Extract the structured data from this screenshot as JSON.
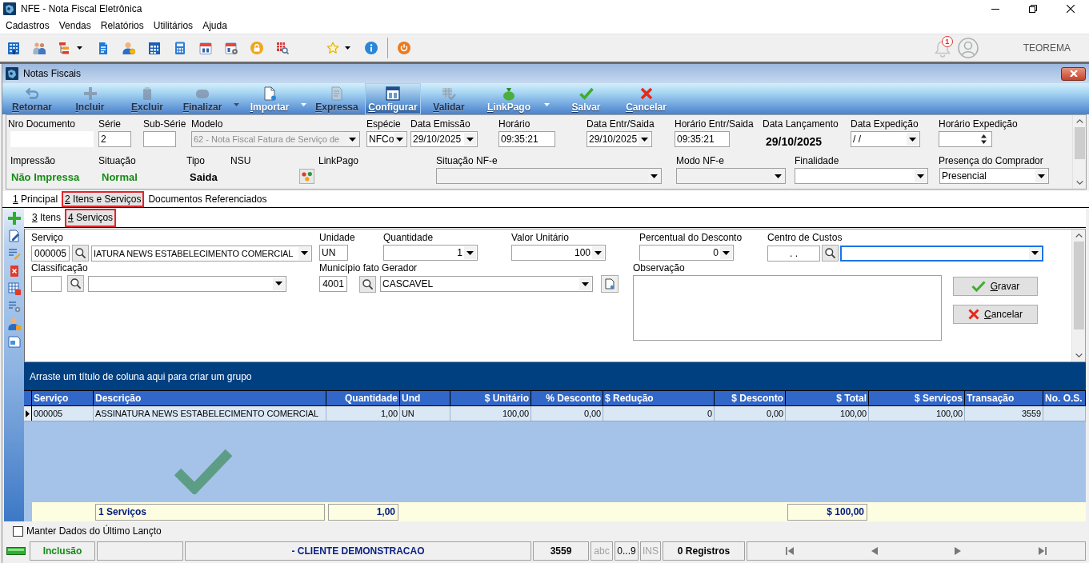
{
  "window": {
    "title": "NFE - Nota Fiscal Eletrônica"
  },
  "menu": [
    "Cadastros",
    "Vendas",
    "Relatórios",
    "Utilitários",
    "Ajuda"
  ],
  "toolbar": {
    "notification_count": "1",
    "user_name": "TEOREMA"
  },
  "child_window": {
    "title": "Notas Fiscais"
  },
  "ribbon": [
    {
      "label": "Retornar",
      "disabled": true,
      "dropdown": false,
      "hovered": false
    },
    {
      "label": "Incluir",
      "disabled": true,
      "dropdown": false,
      "hovered": false
    },
    {
      "label": "Excluir",
      "disabled": true,
      "dropdown": false,
      "hovered": false
    },
    {
      "label": "Finalizar",
      "disabled": true,
      "dropdown": true,
      "hovered": false
    },
    {
      "label": "Importar",
      "disabled": false,
      "dropdown": true,
      "hovered": false
    },
    {
      "label": "Expressa",
      "disabled": true,
      "dropdown": false,
      "hovered": false
    },
    {
      "label": "Configurar",
      "disabled": false,
      "dropdown": false,
      "hovered": true
    },
    {
      "label": "Validar",
      "disabled": true,
      "dropdown": false,
      "hovered": false
    },
    {
      "label": "LinkPago",
      "disabled": false,
      "dropdown": true,
      "hovered": false
    },
    {
      "label": "Salvar",
      "disabled": false,
      "dropdown": false,
      "hovered": false
    },
    {
      "label": "Cancelar",
      "disabled": false,
      "dropdown": false,
      "hovered": false
    }
  ],
  "header": {
    "row_1": [
      {
        "label": "Nro Documento",
        "kind": "plain",
        "disabled": false
      },
      {
        "label": "Série",
        "kind": "input",
        "value": "2",
        "disabled": false
      },
      {
        "label": "Sub-Série",
        "kind": "input",
        "disabled": false
      },
      {
        "label": "Modelo",
        "kind": "dropdown",
        "value": "62 - Nota Fiscal Fatura de Serviço de",
        "disabled": true
      },
      {
        "label": "Espécie",
        "kind": "dropdown",
        "value": "NFCo",
        "disabled": false
      },
      {
        "label": "Data Emissão",
        "kind": "dropdown",
        "value": "29/10/2025",
        "disabled": false
      },
      {
        "label": "Horário",
        "kind": "input",
        "value": "09:35:21",
        "disabled": false
      },
      {
        "label": "Data Entr/Saida",
        "kind": "dropdown",
        "value": "29/10/2025",
        "disabled": false
      },
      {
        "label": "Horário Entr/Saida",
        "kind": "input",
        "value": "09:35:21",
        "disabled": false
      },
      {
        "label": "Data Lançamento",
        "kind": "text",
        "value": "29/10/2025",
        "disabled": false
      },
      {
        "label": "Data Expedição",
        "kind": "dropdown",
        "value": "/ /",
        "disabled": false
      },
      {
        "label": "Horário Expedição",
        "kind": "spin",
        "disabled": false
      }
    ],
    "row_2": [
      {
        "label": "Impressão",
        "kind": "status",
        "value": "Não Impressa",
        "color": "#168a16",
        "disabled": false
      },
      {
        "label": "Situação",
        "kind": "status",
        "value": "Normal",
        "color": "#168a16",
        "disabled": false
      },
      {
        "label": "Tipo",
        "kind": "status",
        "value": "Saida",
        "color": "#000000",
        "disabled": false
      },
      {
        "label": "NSU",
        "kind": "none",
        "disabled": false
      },
      {
        "label": "LinkPago",
        "kind": "button",
        "disabled": false
      },
      {
        "label": "Situação NF-e",
        "kind": "dropdown",
        "disabled": true
      },
      {
        "label": "Modo NF-e",
        "kind": "dropdown",
        "disabled": true
      },
      {
        "label": "Finalidade",
        "kind": "dropdown",
        "disabled": false
      },
      {
        "label": "Presença do Comprador",
        "kind": "dropdown",
        "value": "Presencial",
        "disabled": false
      }
    ]
  },
  "tabs": [
    {
      "label": "1 Principal",
      "selected": false
    },
    {
      "label": "2 Itens e Serviços",
      "selected": true
    },
    {
      "label": "Documentos Referenciados",
      "selected": false
    }
  ],
  "subtabs": [
    {
      "label": "3 Itens",
      "selected": false
    },
    {
      "label": "4 Serviços",
      "selected": true
    }
  ],
  "service_form": {
    "row_1": [
      {
        "label": "Serviço",
        "kind": "lookup",
        "code": "000005",
        "value": "IATURA NEWS ESTABELECIMENTO COMERCIAL",
        "focused": false
      },
      {
        "label": "Unidade",
        "kind": "input",
        "value": "UN",
        "focused": false
      },
      {
        "label": "Quantidade",
        "kind": "number",
        "value": "1",
        "focused": false
      },
      {
        "label": "Valor Unitário",
        "kind": "number",
        "value": "100",
        "focused": false
      },
      {
        "label": "Percentual do Desconto",
        "kind": "number",
        "value": "0",
        "focused": false
      },
      {
        "label": "Centro de Custos",
        "kind": "lookup",
        "code": ". .",
        "focused": true
      }
    ],
    "row_2": [
      {
        "label": "Classificação",
        "kind": "lookup",
        "focused": false
      },
      {
        "label": "Município fato Gerador",
        "kind": "lookup-doc",
        "code": "4001",
        "value": "CASCAVEL",
        "focused": false
      },
      {
        "label": "Observação",
        "kind": "memo",
        "focused": false
      }
    ],
    "buttons": [
      {
        "label": "Gravar",
        "kind": "confirm"
      },
      {
        "label": "Cancelar",
        "kind": "cancel"
      }
    ]
  },
  "grid": {
    "group_hint": "Arraste um título de coluna aqui para criar um grupo",
    "columns": [
      "Serviço",
      "Descrição",
      "Quantidade",
      "Und",
      "$ Unitário",
      "% Desconto",
      "$ Redução",
      "$ Desconto",
      "$ Total",
      "$ Serviços",
      "Transação",
      "No. O.S."
    ],
    "rows": [
      {
        "selected": true,
        "cells": [
          "000005",
          "ASSINATURA NEWS ESTABELECIMENTO COMERCIAL",
          "1,00",
          "UN",
          "100,00",
          "0,00",
          "0",
          "0,00",
          "100,00",
          "100,00",
          "3559"
        ]
      }
    ],
    "footer": {
      "description": "1 Serviços",
      "quantity": "1,00",
      "total": "$ 100,00"
    }
  },
  "keep_data": {
    "label": "Manter Dados do Último Lançto",
    "checked": false
  },
  "status_bar": {
    "mode": "Inclusão",
    "client": "- CLIENTE DEMONSTRACAO",
    "transaction": "3559",
    "indicators": [
      {
        "label": "abc",
        "active": false
      },
      {
        "label": "0...9",
        "active": true
      },
      {
        "label": "INS",
        "active": false
      }
    ],
    "records": "0 Registros"
  }
}
